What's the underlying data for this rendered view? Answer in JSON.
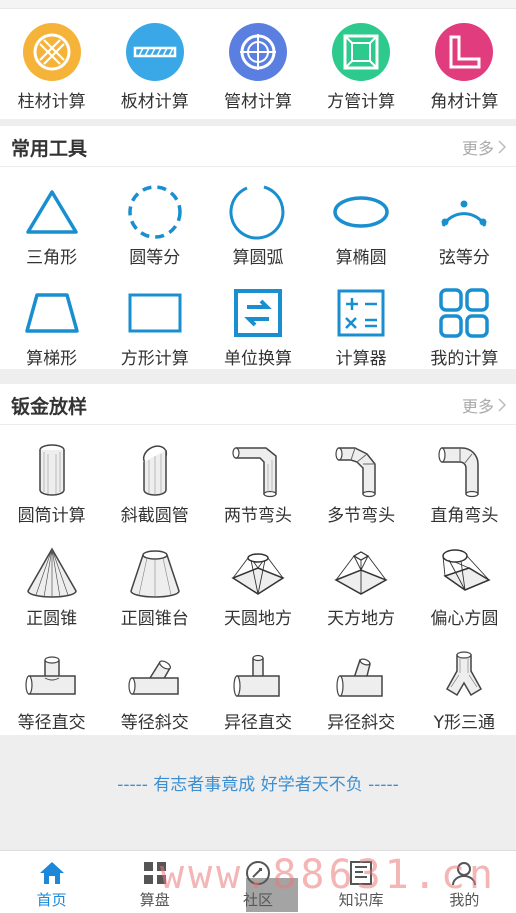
{
  "material_tools": [
    {
      "label": "柱材计算",
      "icon": "round-bar-icon",
      "color": "#f5b33a"
    },
    {
      "label": "板材计算",
      "icon": "plate-icon",
      "color": "#3aa8e6"
    },
    {
      "label": "管材计算",
      "icon": "pipe-icon",
      "color": "#5b7fe0"
    },
    {
      "label": "方管计算",
      "icon": "square-tube-icon",
      "color": "#2ec98c"
    },
    {
      "label": "角材计算",
      "icon": "angle-steel-icon",
      "color": "#e03c7e"
    }
  ],
  "common_tools": {
    "title": "常用工具",
    "more": "更多",
    "items": [
      {
        "label": "三角形",
        "icon": "triangle-icon"
      },
      {
        "label": "圆等分",
        "icon": "circle-divide-icon"
      },
      {
        "label": "算圆弧",
        "icon": "arc-icon"
      },
      {
        "label": "算椭圆",
        "icon": "ellipse-icon"
      },
      {
        "label": "弦等分",
        "icon": "chord-divide-icon"
      },
      {
        "label": "算梯形",
        "icon": "trapezoid-icon"
      },
      {
        "label": "方形计算",
        "icon": "rectangle-icon"
      },
      {
        "label": "单位换算",
        "icon": "unit-convert-icon"
      },
      {
        "label": "计算器",
        "icon": "calculator-icon"
      },
      {
        "label": "我的计算",
        "icon": "my-calc-icon"
      }
    ]
  },
  "sheet_metal": {
    "title": "钣金放样",
    "more": "更多",
    "items": [
      {
        "label": "圆筒计算",
        "icon": "cylinder-icon"
      },
      {
        "label": "斜截圆管",
        "icon": "oblique-pipe-icon"
      },
      {
        "label": "两节弯头",
        "icon": "two-section-elbow-icon"
      },
      {
        "label": "多节弯头",
        "icon": "multi-section-elbow-icon"
      },
      {
        "label": "直角弯头",
        "icon": "right-angle-elbow-icon"
      },
      {
        "label": "正圆锥",
        "icon": "cone-icon"
      },
      {
        "label": "正圆锥台",
        "icon": "frustum-icon"
      },
      {
        "label": "天圆地方",
        "icon": "round-to-square-icon"
      },
      {
        "label": "天方地方",
        "icon": "square-to-square-icon"
      },
      {
        "label": "偏心方圆",
        "icon": "eccentric-round-square-icon"
      },
      {
        "label": "等径直交",
        "icon": "equal-tee-icon"
      },
      {
        "label": "等径斜交",
        "icon": "equal-oblique-tee-icon"
      },
      {
        "label": "异径直交",
        "icon": "reducing-tee-icon"
      },
      {
        "label": "异径斜交",
        "icon": "reducing-oblique-tee-icon"
      },
      {
        "label": "Y形三通",
        "icon": "y-branch-icon"
      }
    ]
  },
  "slogan": "----- 有志者事竟成 好学者天不负 -----",
  "tabs": [
    {
      "label": "首页",
      "icon": "home-icon",
      "active": true
    },
    {
      "label": "算盘",
      "icon": "grid-icon",
      "active": false
    },
    {
      "label": "社区",
      "icon": "community-icon",
      "active": false
    },
    {
      "label": "知识库",
      "icon": "book-icon",
      "active": false
    },
    {
      "label": "我的",
      "icon": "user-icon",
      "active": false
    }
  ],
  "watermark": "www.88631.cn",
  "colors": {
    "accent": "#1e88d8",
    "tool_icon": "#1a8fd0"
  }
}
